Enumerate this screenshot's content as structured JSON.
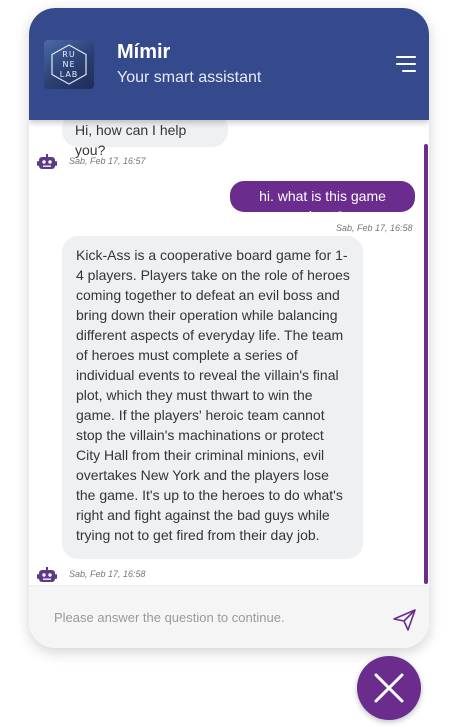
{
  "header": {
    "logo_lines": [
      "RU",
      "NE",
      "LAB"
    ],
    "title": "Mímir",
    "subtitle": "Your smart assistant",
    "menu_icon": "hamburger-menu-icon"
  },
  "messages": [
    {
      "sender": "bot",
      "text": "Hi, how can I help you?",
      "time": "Sab, Feb 17, 16:57"
    },
    {
      "sender": "user",
      "text": "hi. what is this game about?",
      "time": "Sab, Feb 17, 16:58"
    },
    {
      "sender": "bot",
      "text": "Kick-Ass is a cooperative board game for 1-4 players. Players take on the role of heroes coming together to defeat an evil boss and bring down their operation while balancing different aspects of everyday life. The team of heroes must complete a series of individual events to reveal the villain's final plot, which they must thwart to win the game. If the players' heroic team cannot stop the villain's machinations or protect City Hall from their criminal minions, evil overtakes New York and the players lose the game. It's up to the heroes to do what's right and fight against the bad guys while trying not to get fired from their day job.",
      "time": "Sab, Feb 17, 16:58"
    }
  ],
  "composer": {
    "placeholder": "Please answer the question to continue.",
    "value": "",
    "send_icon": "paper-plane-send-icon"
  },
  "close_icon": "close-x-icon",
  "colors": {
    "header": "#354a8c",
    "accent": "#6a2d8e",
    "bot_bubble": "#eff0f2"
  }
}
